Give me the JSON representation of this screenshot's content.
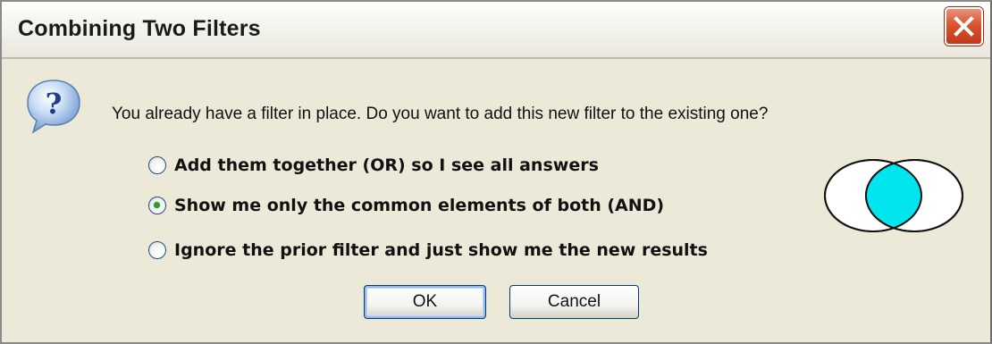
{
  "window": {
    "title": "Combining Two Filters",
    "close_icon": "close-icon"
  },
  "dialog": {
    "icon": "question-icon",
    "message": "You already have a filter in place.  Do you want to add this new filter to the existing one?",
    "options": [
      {
        "label": "Add them together (OR) so I see all answers",
        "selected": false
      },
      {
        "label": "Show me only the common elements of both (AND)",
        "selected": true
      },
      {
        "label": "Ignore the prior filter and just show me the new results",
        "selected": false
      }
    ],
    "buttons": {
      "ok": "OK",
      "cancel": "Cancel"
    },
    "venn_icon": "venn-intersection-icon"
  },
  "colors": {
    "dialog_background": "#ece9d8",
    "close_button": "#d9542f",
    "radio_selected_dot": "#2f9e2a",
    "venn_highlight": "#00e5ee",
    "button_border": "#003c74"
  }
}
